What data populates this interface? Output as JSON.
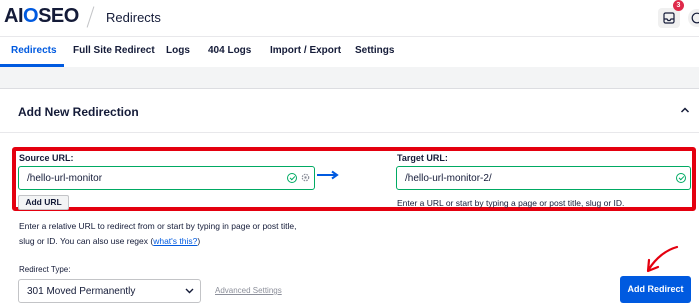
{
  "header": {
    "logo_text": "AIOSEO",
    "page_title": "Redirects",
    "notification_count": "3"
  },
  "tabs": [
    {
      "label": "Redirects",
      "active": true
    },
    {
      "label": "Full Site Redirect",
      "active": false
    },
    {
      "label": "Logs",
      "active": false
    },
    {
      "label": "404 Logs",
      "active": false
    },
    {
      "label": "Import / Export",
      "active": false
    },
    {
      "label": "Settings",
      "active": false
    }
  ],
  "card": {
    "title": "Add New Redirection",
    "source": {
      "label": "Source URL:",
      "value": "/hello-url-monitor",
      "add_url_label": "Add URL",
      "help_line1": "Enter a relative URL to redirect from or start by typing in page or post title,",
      "help_line2": "slug or ID. You can also use regex (",
      "help_link": "what's this?",
      "help_close": ")"
    },
    "target": {
      "label": "Target URL:",
      "value": "/hello-url-monitor-2/",
      "help": "Enter a URL or start by typing a page or post title, slug or ID."
    },
    "redirect_type": {
      "label": "Redirect Type:",
      "selected": "301 Moved Permanently"
    },
    "advanced_settings": "Advanced Settings",
    "add_redirect_button": "Add Redirect"
  },
  "colors": {
    "brand_blue": "#005ae0",
    "valid_green": "#00aa63",
    "highlight_red": "#e4000f"
  }
}
